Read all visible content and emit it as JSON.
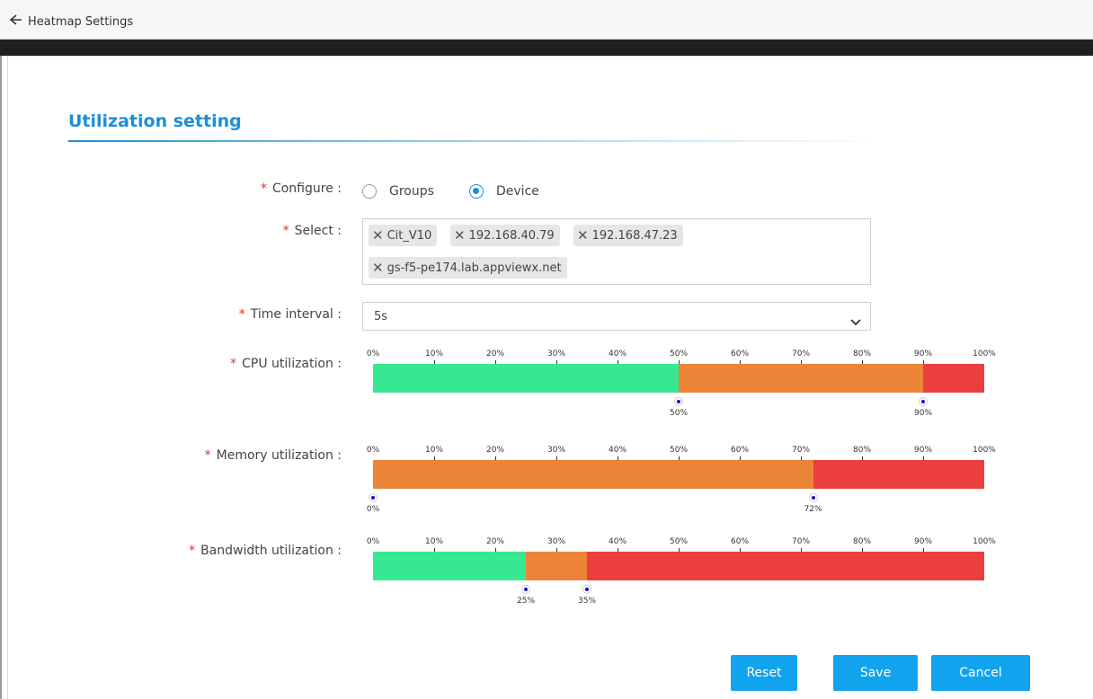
{
  "window": {
    "title": "Heatmap Settings"
  },
  "section": {
    "title": "Utilization setting"
  },
  "colors": {
    "accent": "#1b8fd6",
    "button": "#12a3ee",
    "green": "#36e891",
    "orange": "#ec8438",
    "red": "#ec3e3e",
    "required": "#e0302a"
  },
  "form": {
    "required_mark": "*",
    "configure": {
      "label": "Configure :",
      "options": [
        "Groups",
        "Device"
      ],
      "selected": "Device"
    },
    "select": {
      "label": "Select :",
      "tags": [
        "Cit_V10",
        "192.168.40.79",
        "192.168.47.23",
        "gs-f5-pe174.lab.appviewx.net"
      ]
    },
    "time_interval": {
      "label": "Time interval :",
      "value": "5s"
    },
    "scale_ticks": [
      "0%",
      "10%",
      "20%",
      "30%",
      "40%",
      "50%",
      "60%",
      "70%",
      "80%",
      "90%",
      "100%"
    ],
    "cpu": {
      "label": "CPU utilization :",
      "thresholds": [
        50,
        90
      ],
      "threshold_labels": [
        "50%",
        "90%"
      ]
    },
    "memory": {
      "label": "Memory utilization :",
      "thresholds": [
        0,
        72
      ],
      "threshold_labels": [
        "0%",
        "72%"
      ]
    },
    "bandwidth": {
      "label": "Bandwidth utilization :",
      "thresholds": [
        25,
        35
      ],
      "threshold_labels": [
        "25%",
        "35%"
      ]
    }
  },
  "buttons": {
    "reset": "Reset",
    "save": "Save",
    "cancel": "Cancel"
  }
}
